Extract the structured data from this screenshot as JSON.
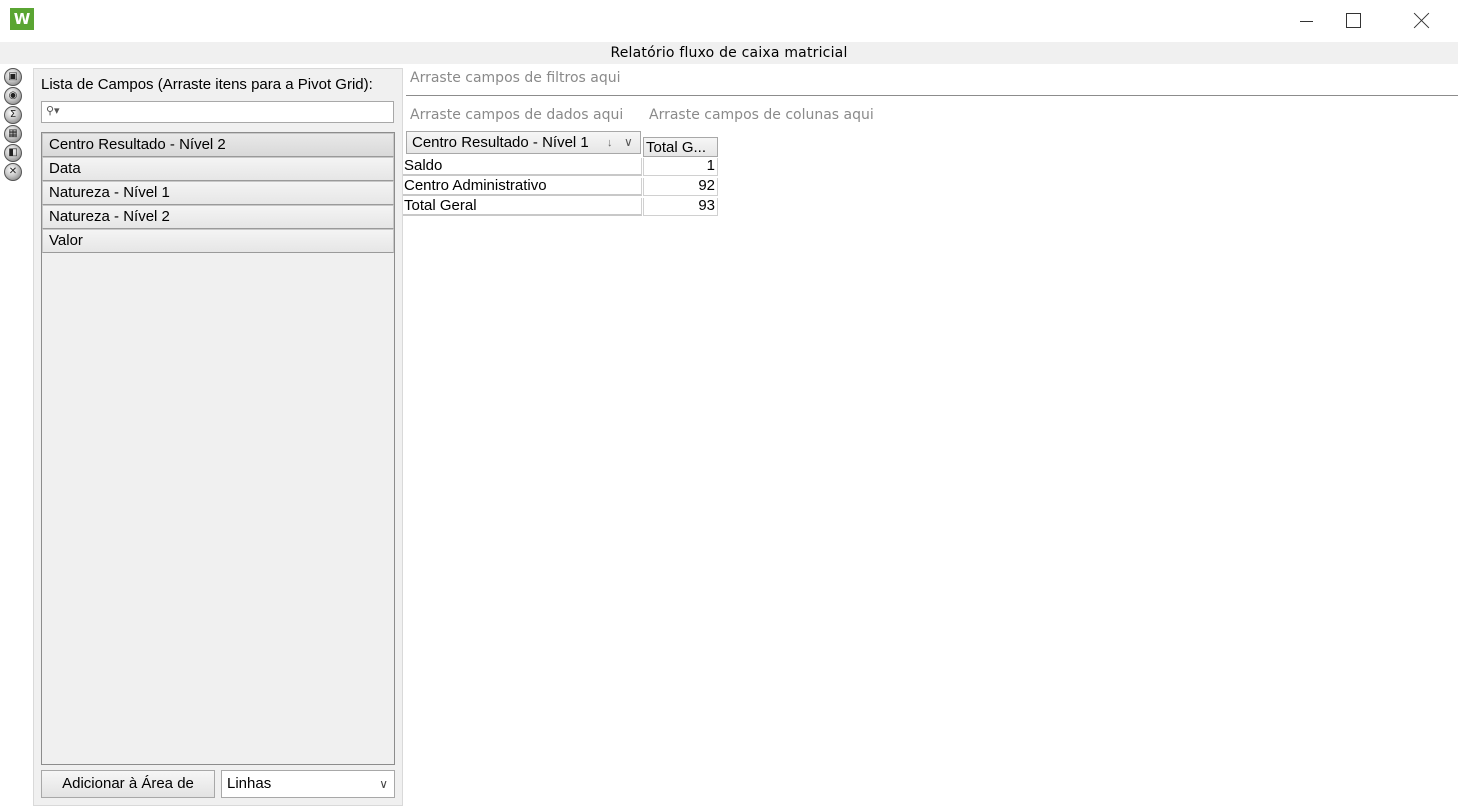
{
  "window": {
    "app_logo": "W",
    "colors": {
      "logo": "#5aa532"
    },
    "controls": {
      "minimize": "minimize-icon",
      "maximize": "maximize-icon",
      "close": "close-icon"
    }
  },
  "report": {
    "title": "Relatório fluxo de caixa matricial"
  },
  "toolstrip": {
    "icons": [
      "print-icon",
      "camera-icon",
      "sum-icon",
      "grid-icon",
      "export-icon",
      "excel-icon"
    ]
  },
  "field_list": {
    "title": "Lista de Campos (Arraste itens para a Pivot Grid):",
    "search": {
      "value": "",
      "placeholder": ""
    },
    "items": [
      {
        "label": "Centro Resultado - Nível 2"
      },
      {
        "label": "Data"
      },
      {
        "label": "Natureza - Nível 1"
      },
      {
        "label": "Natureza - Nível 2"
      },
      {
        "label": "Valor"
      }
    ],
    "add_button_label": "Adicionar à Área de",
    "area_select": {
      "value": "Linhas"
    }
  },
  "pivot": {
    "filter_zone": "Arraste campos de filtros aqui",
    "data_zone": "Arraste campos de dados aqui",
    "column_zone": "Arraste campos de colunas aqui",
    "row_field": {
      "label": "Centro Resultado - Nível 1",
      "sort_glyph": "↓",
      "filter_glyph": "∨"
    },
    "column_header": "Total G...",
    "rows": [
      {
        "label": "Saldo",
        "value": "1"
      },
      {
        "label": "Centro Administrativo",
        "value": "92"
      },
      {
        "label": "Total Geral",
        "value": "93"
      }
    ]
  }
}
